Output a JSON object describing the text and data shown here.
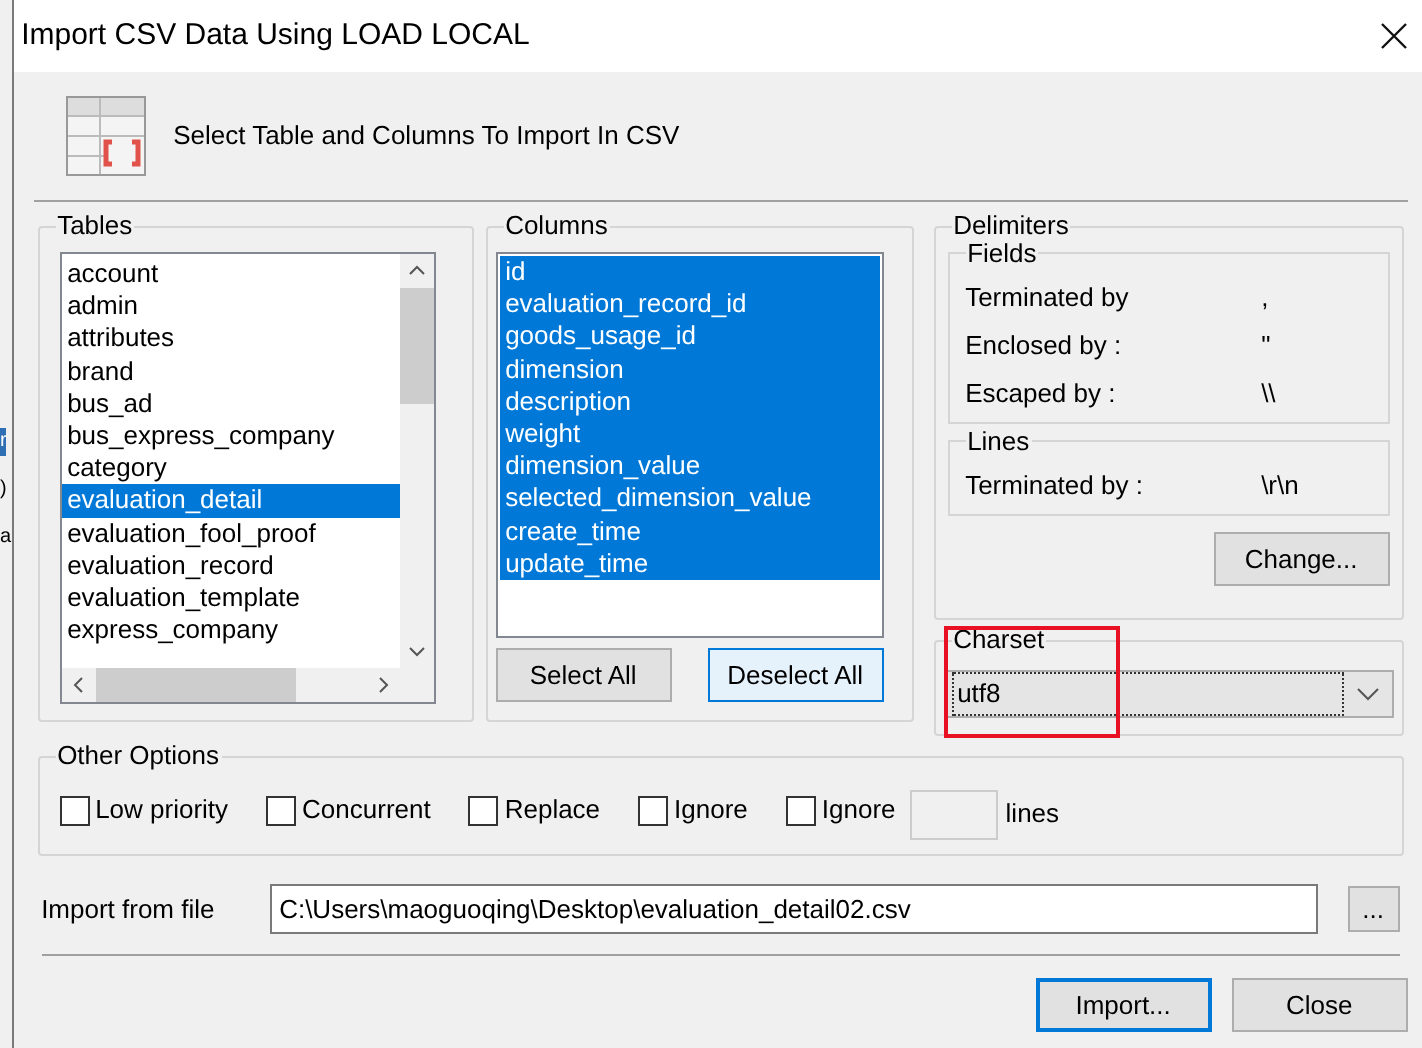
{
  "background_window": {
    "texts": [
      "r",
      ")",
      "a"
    ]
  },
  "window": {
    "title": "Import CSV Data Using LOAD LOCAL"
  },
  "header": {
    "text": "Select Table and Columns To Import In CSV"
  },
  "tables": {
    "label": "Tables",
    "items": [
      {
        "label": "account",
        "selected": false
      },
      {
        "label": "admin",
        "selected": false
      },
      {
        "label": "attributes",
        "selected": false
      },
      {
        "label": "brand",
        "selected": false
      },
      {
        "label": "bus_ad",
        "selected": false
      },
      {
        "label": "bus_express_company",
        "selected": false
      },
      {
        "label": "category",
        "selected": false
      },
      {
        "label": "evaluation_detail",
        "selected": true
      },
      {
        "label": "evaluation_fool_proof",
        "selected": false
      },
      {
        "label": "evaluation_record",
        "selected": false
      },
      {
        "label": "evaluation_template",
        "selected": false
      },
      {
        "label": "express_company",
        "selected": false
      }
    ]
  },
  "columns": {
    "label": "Columns",
    "items": [
      {
        "label": "id",
        "selected": true
      },
      {
        "label": "evaluation_record_id",
        "selected": true
      },
      {
        "label": "goods_usage_id",
        "selected": true
      },
      {
        "label": "dimension",
        "selected": true
      },
      {
        "label": "description",
        "selected": true
      },
      {
        "label": "weight",
        "selected": true
      },
      {
        "label": "dimension_value",
        "selected": true
      },
      {
        "label": "selected_dimension_value",
        "selected": true
      },
      {
        "label": "create_time",
        "selected": true
      },
      {
        "label": "update_time",
        "selected": true
      }
    ],
    "buttons": [
      {
        "label": "Select All",
        "focused": false
      },
      {
        "label": "Deselect All",
        "focused": true
      }
    ]
  },
  "delimiters": {
    "label": "Delimiters",
    "fields": {
      "label": "Fields",
      "rows": [
        {
          "label": "Terminated by",
          "value": ","
        },
        {
          "label": "Enclosed by :",
          "value": "\""
        },
        {
          "label": "Escaped by :",
          "value": "\\\\"
        }
      ]
    },
    "lines": {
      "label": "Lines",
      "rows": [
        {
          "label": "Terminated by :",
          "value": "\\r\\n"
        }
      ]
    },
    "change_button": "Change..."
  },
  "charset": {
    "label": "Charset",
    "value": "utf8",
    "highlighted": true
  },
  "other_options": {
    "label": "Other Options",
    "options": [
      {
        "label": "Low priority",
        "checked": false
      },
      {
        "label": "Concurrent",
        "checked": false
      },
      {
        "label": "Replace",
        "checked": false
      },
      {
        "label": "Ignore",
        "checked": false
      },
      {
        "label": "Ignore",
        "checked": false
      }
    ],
    "lines_label": "lines"
  },
  "import_file": {
    "label": "Import from file",
    "value": "C:\\Users\\maoguoqing\\Desktop\\evaluation_detail02.csv",
    "browse": "..."
  },
  "buttons": [
    {
      "label": "Import...",
      "default": true
    },
    {
      "label": "Close",
      "default": false
    }
  ]
}
